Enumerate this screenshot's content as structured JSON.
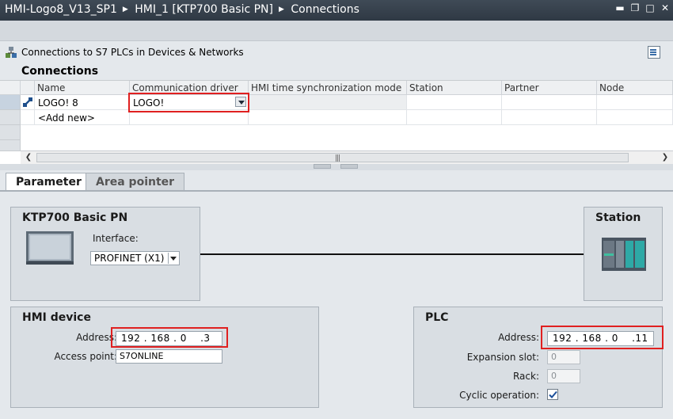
{
  "title_bar": {
    "crumbs": [
      "HMI-Logo8_V13_SP1",
      "HMI_1 [KTP700 Basic PN]",
      "Connections"
    ]
  },
  "subbar": {
    "text": "Connections to S7 PLCs in Devices & Networks"
  },
  "connections": {
    "heading": "Connections",
    "columns": [
      "Name",
      "Communication driver",
      "HMI time synchronization mode",
      "Station",
      "Partner",
      "Node"
    ],
    "rows": [
      {
        "name": "LOGO! 8",
        "driver": "LOGO!",
        "sync": "",
        "station": "",
        "partner": "",
        "node": ""
      },
      {
        "name": "<Add new>",
        "driver": "",
        "sync": "",
        "station": "",
        "partner": "",
        "node": ""
      }
    ]
  },
  "tabs": [
    "Parameter",
    "Area pointer"
  ],
  "device_box": {
    "title": "KTP700 Basic PN",
    "interface_label": "Interface:",
    "interface_value": "PROFINET (X1)"
  },
  "station_box": {
    "title": "Station"
  },
  "hmi_device": {
    "title": "HMI device",
    "address_label": "Address:",
    "address_value": "192 . 168 . 0    .3",
    "access_point_label": "Access point:",
    "access_point_value": "S7ONLINE"
  },
  "plc": {
    "title": "PLC",
    "address_label": "Address:",
    "address_value": "192 . 168 . 0    .11",
    "expansion_slot_label": "Expansion slot:",
    "expansion_slot_value": "0",
    "rack_label": "Rack:",
    "rack_value": "0",
    "cyclic_label": "Cyclic operation:",
    "cyclic_checked": true
  },
  "colors": {
    "highlight": "#e02020",
    "title_bar": "#3a4550"
  }
}
